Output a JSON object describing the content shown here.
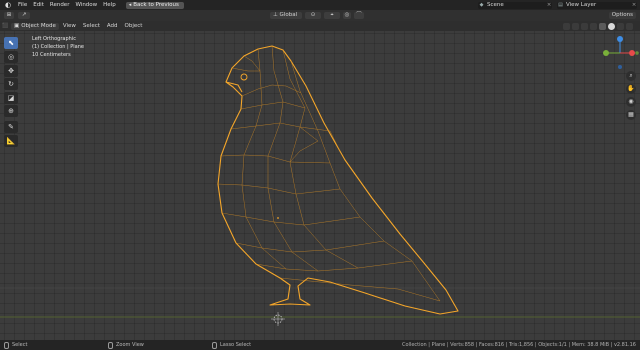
{
  "topbar": {
    "menus": [
      "File",
      "Edit",
      "Render",
      "Window",
      "Help"
    ],
    "back_button": "Back to Previous",
    "scene": "Scene",
    "view_layer": "View Layer"
  },
  "header": {
    "orientation": "Global",
    "options": "Options"
  },
  "viewport_header": {
    "mode": "Object Mode",
    "menus": [
      "View",
      "Select",
      "Add",
      "Object"
    ]
  },
  "overlay": {
    "view_name": "Left Orthographic",
    "collection": "(1) Collection | Plane",
    "scale": "10 Centimeters"
  },
  "toolbar": {
    "tools": [
      "select-box",
      "cursor",
      "move",
      "rotate",
      "scale",
      "transform",
      "annotate",
      "measure"
    ]
  },
  "gizmo": {
    "axes": [
      "X",
      "Y",
      "Z"
    ],
    "colors": {
      "x": "#e64a4a",
      "y": "#7ab03a",
      "z": "#3e8ee6"
    }
  },
  "statusbar": {
    "select": "Select",
    "zoom": "Zoom View",
    "lasso": "Lasso Select",
    "stats": "Collection | Plane | Verts:858 | Faces:816 | Tris:1,856 | Objects:1/1 | Mem: 38.8 MiB | v2.81.16"
  },
  "colors": {
    "accent": "#4772b3",
    "wire_selected": "#f4a62a",
    "viewport_bg": "#3c3c3c"
  }
}
